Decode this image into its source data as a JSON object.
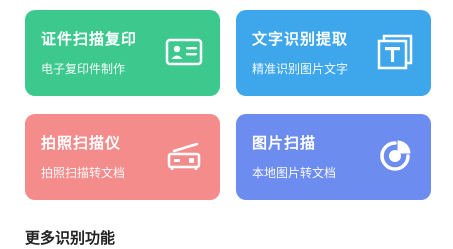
{
  "cards": [
    {
      "title": "证件扫描复印",
      "subtitle": "电子复印件制作",
      "icon": "id-card-icon"
    },
    {
      "title": "文字识别提取",
      "subtitle": "精准识别图片文字",
      "icon": "text-recognition-icon"
    },
    {
      "title": "拍照扫描仪",
      "subtitle": "拍照扫描转文档",
      "icon": "scanner-icon"
    },
    {
      "title": "图片扫描",
      "subtitle": "本地图片转文档",
      "icon": "pie-chart-icon"
    }
  ],
  "section": {
    "title": "更多识别功能"
  },
  "colors": {
    "card_green": "#3dc98e",
    "card_blue": "#3ea6ea",
    "card_pink": "#f58c8c",
    "card_purple": "#6d8cef"
  }
}
